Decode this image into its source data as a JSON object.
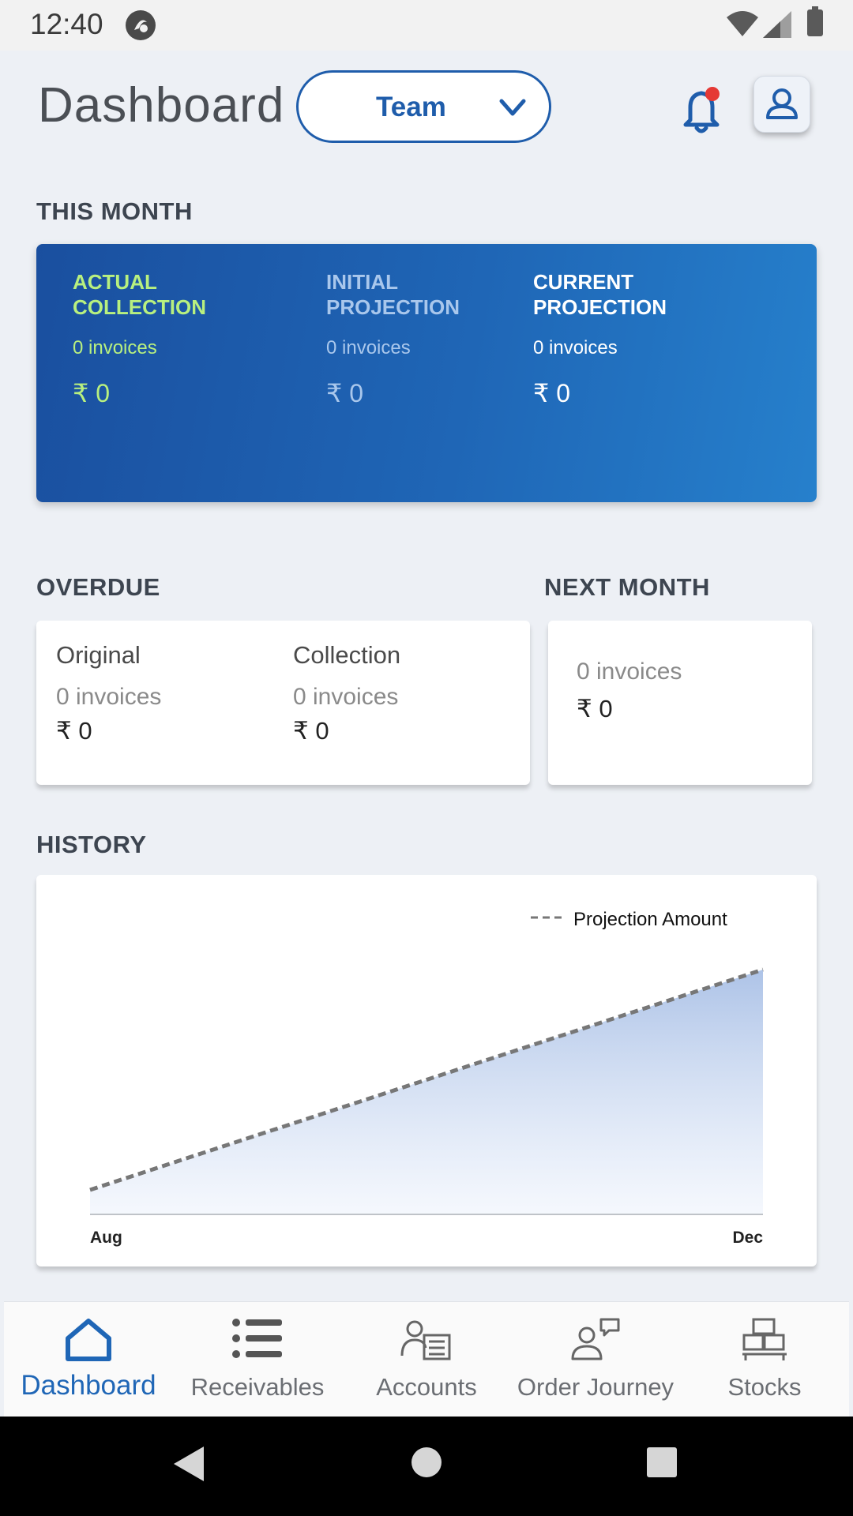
{
  "status_bar": {
    "time": "12:40"
  },
  "header": {
    "title": "Dashboard",
    "team_select": "Team"
  },
  "this_month": {
    "label": "THIS MONTH",
    "columns": [
      {
        "title": "ACTUAL COLLECTION",
        "invoices": "0 invoices",
        "amount": "₹ 0"
      },
      {
        "title": "INITIAL PROJECTION",
        "invoices": "0 invoices",
        "amount": "₹ 0"
      },
      {
        "title": "CURRENT PROJECTION",
        "invoices": "0 invoices",
        "amount": "₹ 0"
      }
    ]
  },
  "overdue": {
    "label": "OVERDUE",
    "original": {
      "title": "Original",
      "invoices": "0 invoices",
      "amount": "₹ 0"
    },
    "collection": {
      "title": "Collection",
      "invoices": "0 invoices",
      "amount": "₹ 0"
    }
  },
  "next_month": {
    "label": "NEXT MONTH",
    "invoices": "0 invoices",
    "amount": "₹ 0"
  },
  "history": {
    "label": "HISTORY"
  },
  "chart_data": {
    "type": "area",
    "x": [
      "Aug",
      "Dec"
    ],
    "series": [
      {
        "name": "Projection Amount",
        "values": [
          0.1,
          1.0
        ],
        "style": "dashed",
        "color": "#777777",
        "fill": "#aec4e8"
      }
    ],
    "xlabel": "",
    "ylabel": "",
    "legend": "top-right",
    "grid": false
  },
  "bottom_nav": {
    "items": [
      {
        "label": "Dashboard",
        "icon": "home-icon",
        "active": true
      },
      {
        "label": "Receivables",
        "icon": "list-icon",
        "active": false
      },
      {
        "label": "Accounts",
        "icon": "accounts-icon",
        "active": false
      },
      {
        "label": "Order Journey",
        "icon": "order-journey-icon",
        "active": false
      },
      {
        "label": "Stocks",
        "icon": "stocks-icon",
        "active": false
      }
    ]
  },
  "colors": {
    "brand": "#1f5dab",
    "actual_collection": "#b8f07f",
    "notification_dot": "#e53935"
  }
}
